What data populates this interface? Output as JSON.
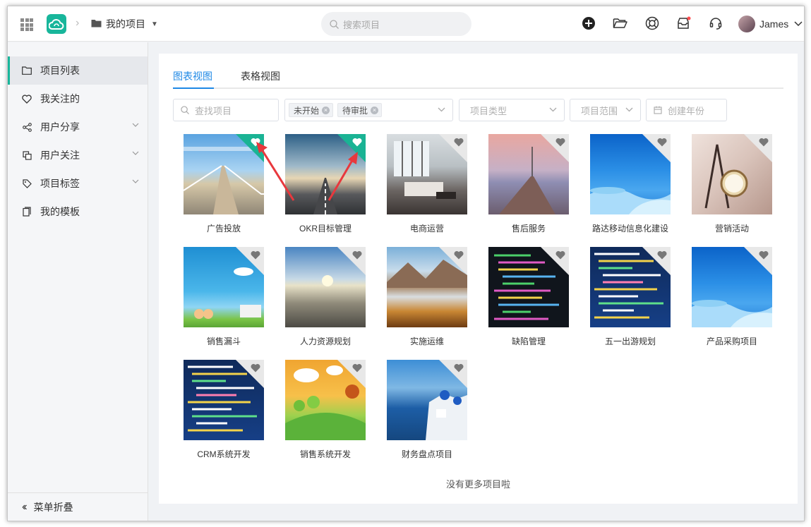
{
  "header": {
    "project_menu_label": "我的项目",
    "search_placeholder": "搜索项目",
    "user_name": "James",
    "icons": [
      "apps-grid-icon",
      "cloud-logo-icon",
      "plus-circle-icon",
      "folder-open-icon",
      "help-ring-icon",
      "inbox-icon",
      "headset-icon"
    ],
    "notification_dot_color": "#ff4d4f"
  },
  "sidebar": {
    "items": [
      {
        "label": "项目列表",
        "icon": "folder-icon",
        "active": true,
        "expandable": false
      },
      {
        "label": "我关注的",
        "icon": "heart-outline-icon",
        "active": false,
        "expandable": false
      },
      {
        "label": "用户分享",
        "icon": "share-icon",
        "active": false,
        "expandable": true
      },
      {
        "label": "用户关注",
        "icon": "copy-icon",
        "active": false,
        "expandable": true
      },
      {
        "label": "项目标签",
        "icon": "tag-icon",
        "active": false,
        "expandable": true
      },
      {
        "label": "我的模板",
        "icon": "template-icon",
        "active": false,
        "expandable": false
      }
    ],
    "collapse_label": "菜单折叠"
  },
  "tabs": [
    {
      "label": "图表视图",
      "active": true
    },
    {
      "label": "表格视图",
      "active": false
    }
  ],
  "filters": {
    "search_placeholder": "查找项目",
    "status_tags": [
      "未开始",
      "待审批"
    ],
    "type_placeholder": "项目类型",
    "scope_placeholder": "项目范围",
    "year_placeholder": "创建年份"
  },
  "projects": [
    {
      "name": "广告投放",
      "favorited": true,
      "theme": "pier-sky"
    },
    {
      "name": "OKR目标管理",
      "favorited": true,
      "theme": "road-sunset"
    },
    {
      "name": "电商运营",
      "favorited": false,
      "theme": "interior"
    },
    {
      "name": "售后服务",
      "favorited": false,
      "theme": "pier-dusk"
    },
    {
      "name": "路达移动信息化建设",
      "favorited": false,
      "theme": "blue-waves"
    },
    {
      "name": "营销活动",
      "favorited": false,
      "theme": "eiffel-clock"
    },
    {
      "name": "销售漏斗",
      "favorited": false,
      "theme": "cartoon-kids"
    },
    {
      "name": "人力资源规划",
      "favorited": false,
      "theme": "city-sun"
    },
    {
      "name": "实施运维",
      "favorited": false,
      "theme": "mountains"
    },
    {
      "name": "缺陷管理",
      "favorited": false,
      "theme": "code-dark"
    },
    {
      "name": "五一出游规划",
      "favorited": false,
      "theme": "code-blue"
    },
    {
      "name": "产品采购项目",
      "favorited": false,
      "theme": "blue-waves"
    },
    {
      "name": "CRM系统开发",
      "favorited": false,
      "theme": "code-blue"
    },
    {
      "name": "销售系统开发",
      "favorited": false,
      "theme": "cartoon-field"
    },
    {
      "name": "财务盘点项目",
      "favorited": false,
      "theme": "santorini"
    }
  ],
  "footer_text": "没有更多项目啦",
  "colors": {
    "accent_teal": "#1ab394",
    "tab_blue": "#1e88e5",
    "annotation_red": "#e8383d"
  }
}
